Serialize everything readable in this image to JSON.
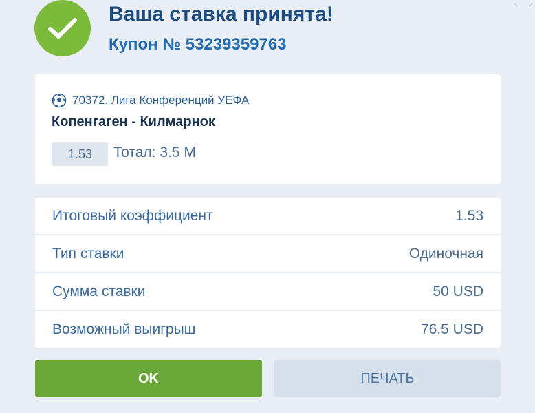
{
  "header": {
    "title": "Ваша ставка принята!",
    "coupon": "Купон № 53239359763"
  },
  "event": {
    "league": "70372. Лига Конференций УЕФА",
    "match": "Копенгаген - Килмарнок",
    "odds": "1.53",
    "bet": "Тотал: 3.5 М"
  },
  "summary": {
    "rows": [
      {
        "label": "Итоговый коэффициент",
        "value": "1.53"
      },
      {
        "label": "Тип ставки",
        "value": "Одиночная"
      },
      {
        "label": "Сумма ставки",
        "value": "50 USD"
      },
      {
        "label": "Возможный выигрыш",
        "value": "76.5 USD"
      }
    ]
  },
  "buttons": {
    "ok_label": "OK",
    "print_label": "ПЕЧАТЬ"
  },
  "icons": {
    "success": "checkmark-circle-icon",
    "sport": "soccer-ball-icon"
  },
  "colors": {
    "success_green": "#7cba3b",
    "primary_button": "#6aa839",
    "title_blue": "#1b4b7f",
    "link_blue": "#236bb0"
  }
}
